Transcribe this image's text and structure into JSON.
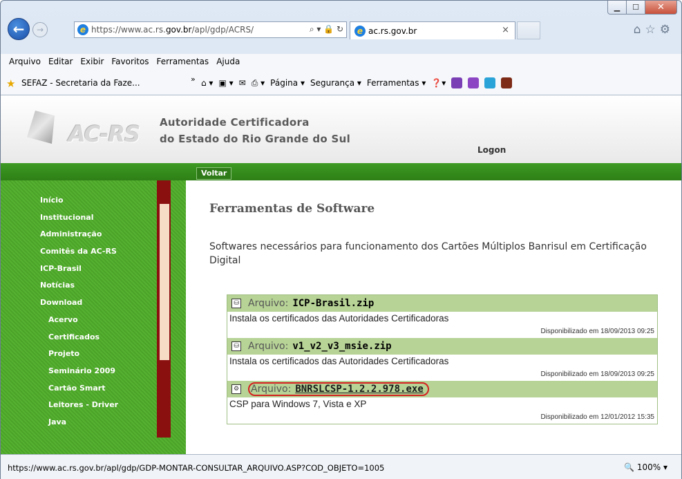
{
  "browser": {
    "address_prefix": "https://www.ac.rs.",
    "address_host": "gov.br",
    "address_path": "/apl/gdp/ACRS/",
    "tab_title": "ac.rs.gov.br",
    "menu": [
      "Arquivo",
      "Editar",
      "Exibir",
      "Favoritos",
      "Ferramentas",
      "Ajuda"
    ],
    "favorite_link": "SEFAZ - Secretaria da Faze...",
    "command_items": [
      "Página ▾",
      "Segurança ▾",
      "Ferramentas ▾"
    ],
    "status_url": "https://www.ac.rs.gov.br/apl/gdp/GDP-MONTAR-CONSULTAR_ARQUIVO.ASP?COD_OBJETO=1005",
    "zoom": "100%"
  },
  "site": {
    "logo_text": "AC-RS",
    "org_line1": "Autoridade Certificadora",
    "org_line2": "do Estado do Rio Grande do Sul",
    "logon": "Logon",
    "back_button": "Voltar",
    "sidebar": [
      {
        "label": "Início",
        "sub": false
      },
      {
        "label": "Institucional",
        "sub": false
      },
      {
        "label": "Administração",
        "sub": false
      },
      {
        "label": "Comitês da AC-RS",
        "sub": false
      },
      {
        "label": "ICP-Brasil",
        "sub": false
      },
      {
        "label": "Notícias",
        "sub": false
      },
      {
        "label": "Download",
        "sub": false
      },
      {
        "label": "Acervo",
        "sub": true
      },
      {
        "label": "Certificados",
        "sub": true
      },
      {
        "label": "Projeto",
        "sub": true
      },
      {
        "label": "Seminário 2009",
        "sub": true
      },
      {
        "label": "Cartão Smart",
        "sub": true
      },
      {
        "label": "Leitores - Driver",
        "sub": true
      },
      {
        "label": "Java",
        "sub": true
      }
    ],
    "title": "Ferramentas de Software",
    "description": "Softwares necessários para funcionamento dos Cartões Múltiplos Banrisul em Certificação Digital",
    "files": [
      {
        "prefix": "Arquivo:",
        "name": "ICP-Brasil.zip",
        "desc": "Instala os certificados das Autoridades Certificadoras",
        "date": "Disponibilizado em 18/09/2013 09:25"
      },
      {
        "prefix": "Arquivo:",
        "name": "v1_v2_v3_msie.zip",
        "desc": "Instala os certificados das Autoridades Certificadoras",
        "date": "Disponibilizado em 18/09/2013 09:25"
      },
      {
        "prefix": "Arquivo:",
        "name": "BNRSLCSP-1.2.2.978.exe",
        "desc": "CSP para Windows 7, Vista e XP",
        "date": "Disponibilizado em 12/01/2012 15:35"
      }
    ]
  }
}
